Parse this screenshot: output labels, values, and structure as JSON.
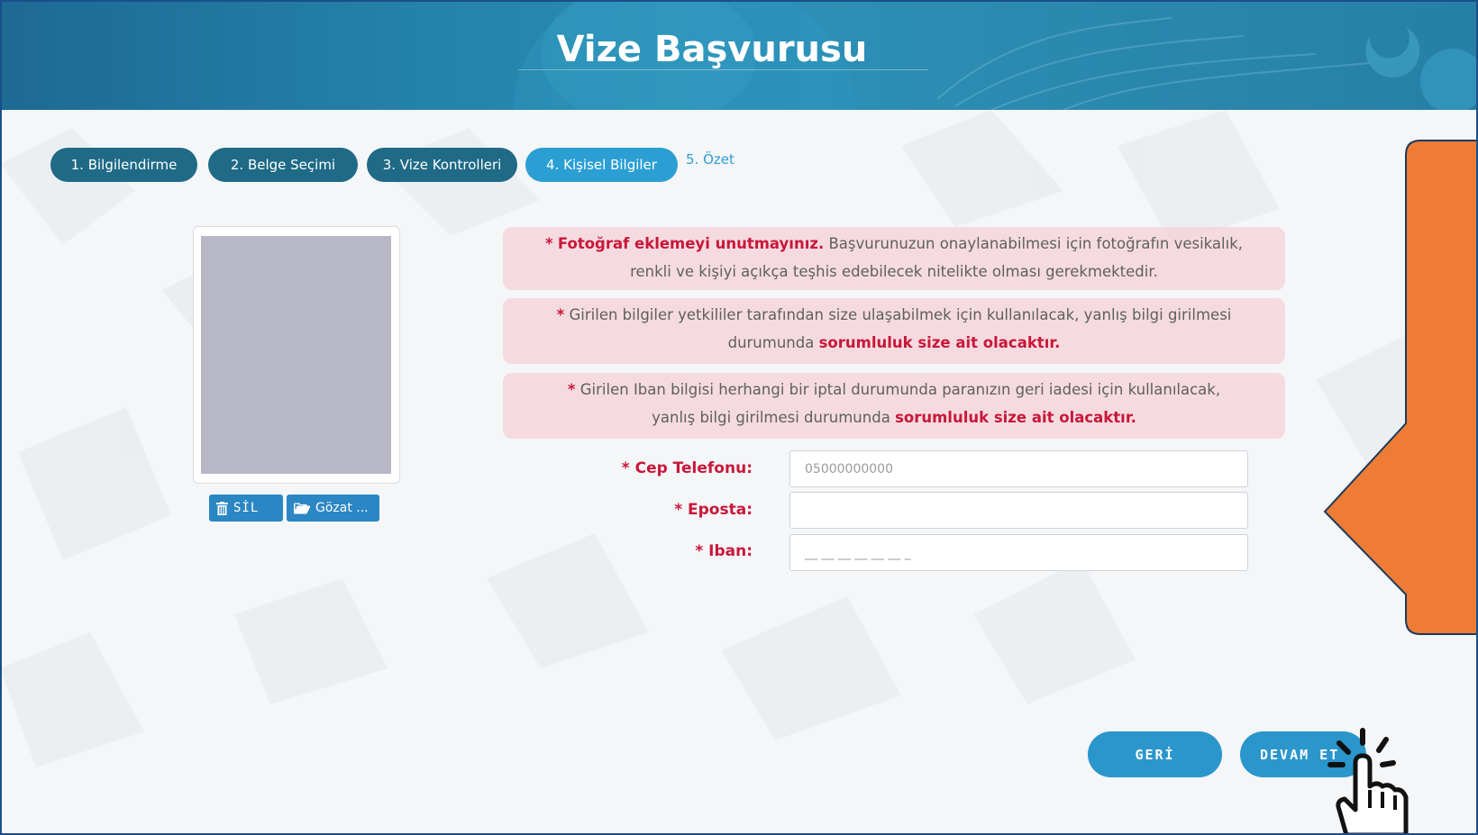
{
  "header": {
    "title": "Vize Başvurusu"
  },
  "steps": [
    {
      "label": "1. Bilgilendirme",
      "state": "done"
    },
    {
      "label": "2. Belge Seçimi",
      "state": "done"
    },
    {
      "label": "3. Vize Kontrolleri",
      "state": "done"
    },
    {
      "label": "4. Kişisel Bilgiler",
      "state": "active"
    },
    {
      "label": "5. Özet",
      "state": "pending"
    }
  ],
  "photo": {
    "delete_label": "SİL",
    "browse_label": "Gözat ..."
  },
  "notices": {
    "n1": {
      "star": "*",
      "bold": "Fotoğraf eklemeyi unutmayınız.",
      "line1": "Başvurunuzun onaylanabilmesi için fotoğrafın vesikalık,",
      "line2": "renkli ve kişiyi açıkça teşhis edebilecek nitelikte olması gerekmektedir."
    },
    "n2": {
      "star": "*",
      "line1": "Girilen bilgiler yetkililer tarafından size ulaşabilmek için kullanılacak, yanlış bilgi girilmesi",
      "line2_prefix": "durumunda",
      "bold": "sorumluluk size ait olacaktır."
    },
    "n3": {
      "star": "*",
      "line1": "Girilen Iban bilgisi herhangi bir iptal durumunda paranızın geri iadesi için kullanılacak,",
      "line2_prefix": "yanlış bilgi girilmesi durumunda",
      "bold": "sorumluluk size ait olacaktır."
    }
  },
  "form": {
    "phone": {
      "label": "* Cep Telefonu:",
      "placeholder": "05000000000",
      "value": ""
    },
    "email": {
      "label": "* Eposta:",
      "placeholder": "",
      "value": ""
    },
    "iban": {
      "label": "* Iban:",
      "placeholder": "__ __ __ __ __ __ _",
      "value": ""
    }
  },
  "buttons": {
    "back": "GERİ",
    "next": "DEVAM ET"
  },
  "colors": {
    "header": "#2583ab",
    "step_done": "#1f6a86",
    "step_active": "#2b9fd4",
    "alert_text": "#c8173a",
    "notice_bg": "#f6d2d8",
    "callout": "#ee7c34",
    "button": "#2a96cc"
  },
  "icons": {
    "delete": "trash-icon",
    "browse": "folder-open-icon",
    "pointer": "hand-pointer-click-icon"
  }
}
